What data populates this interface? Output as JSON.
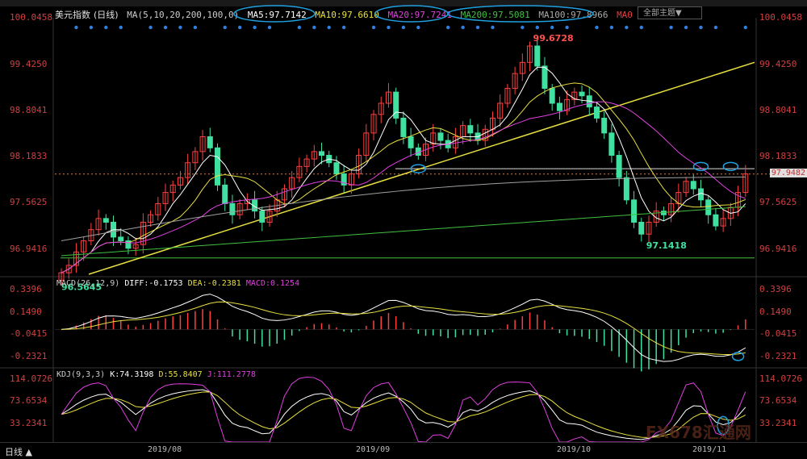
{
  "window": {
    "symbol_title": "美元指数",
    "period": "(日线)",
    "theme_dropdown": "全部主题▼",
    "timeframe_button": "日线 ▲"
  },
  "ma_legend": {
    "params": "MA(5,10,20,200,100,0)",
    "ma5": "MA5:97.7142",
    "ma10": "MA10:97.6610",
    "ma20": "MA20:97.7241",
    "ma200": "MA200:97.5081",
    "ma100": "MA100:97.8966",
    "ma0": "MA0"
  },
  "macd_legend": {
    "params": "MACD(26,12,9)",
    "diff": "DIFF:-0.1753",
    "dea": "DEA:-0.2381",
    "macd": "MACD:0.1254"
  },
  "kdj_legend": {
    "params": "KDJ(9,3,3)",
    "k": "K:74.3198",
    "d": "D:55.8407",
    "j": "J:111.2778"
  },
  "price_axis_labels": [
    "100.0458",
    "99.4250",
    "98.8041",
    "98.1833",
    "97.5625",
    "96.9416"
  ],
  "macd_axis_labels": [
    "0.3396",
    "0.1490",
    "-0.0415",
    "-0.2321"
  ],
  "kdj_axis_labels": [
    "114.0726",
    "73.6534",
    "33.2341"
  ],
  "annotations": {
    "high": "99.6728",
    "low_start": "96.5645",
    "low_mid": "97.1418",
    "last_price": "97.9482"
  },
  "date_labels": [
    "2019/08",
    "2019/09",
    "2019/10",
    "2019/11"
  ],
  "watermark": "FX678汇通网",
  "colors": {
    "up": "#ff4040",
    "down": "#40e0a0",
    "ma5": "#ffffff",
    "ma10": "#e8e040",
    "ma20": "#e040e0",
    "ma100": "#a0a0a0",
    "ma200": "#40c040",
    "trend": "#e8e040",
    "hl_circle": "#20a0e0"
  },
  "chart_data": {
    "type": "candlestick",
    "title": "美元指数 (日线)",
    "ylim": [
      96.6,
      100.05
    ],
    "closes": [
      96.62,
      96.72,
      96.9,
      97.05,
      97.2,
      97.35,
      97.3,
      97.1,
      97.05,
      96.95,
      97.0,
      97.3,
      97.4,
      97.55,
      97.7,
      97.8,
      97.9,
      98.1,
      98.25,
      98.45,
      98.3,
      97.8,
      97.55,
      97.4,
      97.55,
      97.6,
      97.45,
      97.3,
      97.45,
      97.6,
      97.75,
      97.9,
      98.05,
      98.15,
      98.25,
      98.2,
      98.1,
      97.95,
      97.8,
      97.95,
      98.2,
      98.5,
      98.75,
      98.9,
      99.05,
      98.7,
      98.45,
      98.3,
      98.2,
      98.35,
      98.5,
      98.4,
      98.3,
      98.45,
      98.6,
      98.5,
      98.4,
      98.55,
      98.7,
      98.9,
      99.1,
      99.3,
      99.45,
      99.67,
      99.4,
      99.1,
      98.9,
      98.8,
      98.95,
      99.05,
      99.0,
      98.85,
      98.7,
      98.5,
      98.2,
      97.9,
      97.6,
      97.3,
      97.14,
      97.3,
      97.45,
      97.4,
      97.55,
      97.7,
      97.85,
      97.75,
      97.6,
      97.4,
      97.25,
      97.35,
      97.5,
      97.7,
      97.95
    ],
    "ma_last": {
      "MA5": 97.7142,
      "MA10": 97.661,
      "MA20": 97.7241,
      "MA200": 97.5081,
      "MA100": 97.8966
    },
    "high": 99.6728,
    "low": 96.5645,
    "x_tick_labels": [
      "2019/08",
      "2019/09",
      "2019/10",
      "2019/11"
    ],
    "macd": {
      "diff_last": -0.1753,
      "dea_last": -0.2381,
      "macd_last": 0.1254,
      "ylim": [
        -0.32,
        0.4
      ]
    },
    "kdj": {
      "k_last": 74.3198,
      "d_last": 55.8407,
      "j_last": 111.2778,
      "ylim": [
        0,
        125
      ]
    }
  }
}
